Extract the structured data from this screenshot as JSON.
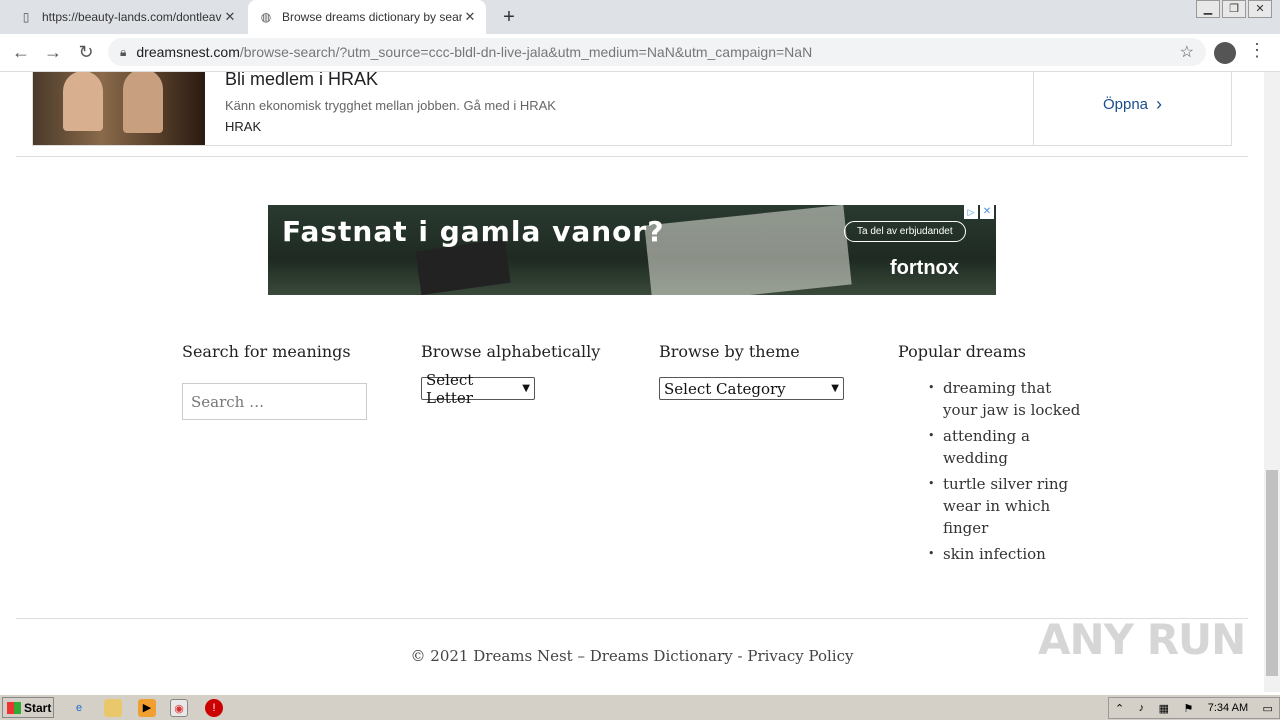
{
  "browser": {
    "tabs": [
      {
        "title": "https://beauty-lands.com/dontleave",
        "active": false
      },
      {
        "title": "Browse dreams dictionary by search",
        "active": true
      }
    ],
    "url_domain": "dreamsnest.com",
    "url_path": "/browse-search/?utm_source=ccc-bldl-dn-live-jala&utm_medium=NaN&utm_campaign=NaN"
  },
  "ad_top": {
    "headline": "Bli medlem i HRAK",
    "description": "Känn ekonomisk trygghet mellan jobben. Gå med i HRAK",
    "brand": "HRAK",
    "cta": "Öppna"
  },
  "ad_banner": {
    "headline": "Fastnat i gamla vanor?",
    "cta": "Ta del av erbjudandet",
    "brand": "fortnox"
  },
  "widgets": {
    "search": {
      "title": "Search for meanings",
      "placeholder": "Search …"
    },
    "alphabet": {
      "title": "Browse alphabetically",
      "selected": "Select Letter"
    },
    "theme": {
      "title": "Browse by theme",
      "selected": "Select Category"
    },
    "popular": {
      "title": "Popular dreams",
      "items": [
        "dreaming that your jaw is locked",
        "attending a wedding",
        "turtle silver ring wear in which finger",
        "skin infection"
      ]
    }
  },
  "footer": {
    "copyright": "© 2021 Dreams Nest – Dreams Dictionary",
    "separator": " - ",
    "privacy": "Privacy Policy"
  },
  "watermark": "ANY RUN",
  "taskbar": {
    "start": "Start",
    "time": "7:34 AM"
  }
}
